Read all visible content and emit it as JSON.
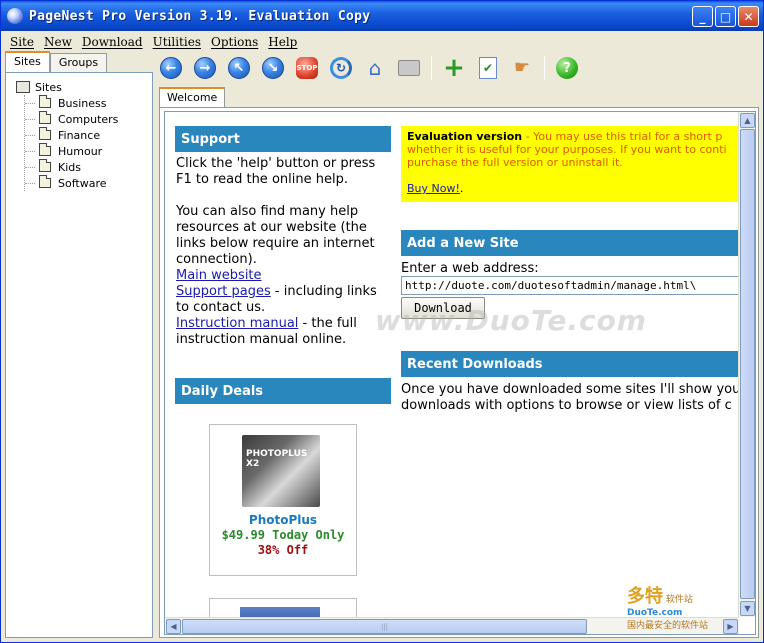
{
  "window": {
    "title": "PageNest Pro Version 3.19. Evaluation Copy",
    "controls": {
      "minimize": "_",
      "maximize": "□",
      "close": "✕"
    }
  },
  "menu": [
    "Site",
    "New",
    "Download",
    "Utilities",
    "Options",
    "Help"
  ],
  "left_tabs": [
    "Sites",
    "Groups"
  ],
  "tree": {
    "root": "Sites",
    "children": [
      "Business",
      "Computers",
      "Finance",
      "Humour",
      "Kids",
      "Software"
    ]
  },
  "toolbar": {
    "icons": [
      "back-icon",
      "forward-icon",
      "up-icon",
      "download-icon",
      "stop-icon",
      "refresh-icon",
      "home-icon",
      "print-icon",
      "add-icon",
      "checklist-icon",
      "hand-icon",
      "help-icon"
    ],
    "stop_label": "STOP"
  },
  "content_tab": "Welcome",
  "support": {
    "heading": "Support",
    "p1_line1": "Click the 'help' button or press",
    "p1_line2": "F1 to read the online help.",
    "p2_line1": "You can also find many help",
    "p2_line2": "resources at our website (the",
    "p2_line3": "links below require an internet",
    "p2_line4": "connection).",
    "link_main": "Main website",
    "link_support": "Support pages",
    "support_suffix": " - including links",
    "support_line2": "to contact us.",
    "link_manual": "Instruction manual",
    "manual_suffix": " - the full",
    "manual_line2": "instruction manual online."
  },
  "evaluation": {
    "title": "Evaluation version",
    "text1": " - You may use this trial for a short p",
    "text2": "whether it is useful for your purposes. If you want to conti",
    "text3": "purchase the full version or uninstall it.",
    "buy_link": "Buy Now!",
    "buy_suffix": "."
  },
  "add_site": {
    "heading": "Add a New Site",
    "label": "Enter a web address:",
    "value": "http://duote.com/duotesoftadmin/manage.html\\",
    "button": "Download"
  },
  "recent": {
    "heading": "Recent Downloads",
    "line1": "Once you have downloaded some sites I'll show you",
    "line2": "downloads with options to browse or view lists of c"
  },
  "deals": {
    "heading": "Daily Deals",
    "product_box_text": "PHOTOPLUS X2",
    "product": "PhotoPlus",
    "price": "$49.99 Today Only",
    "discount": "38% Off"
  },
  "watermark": "www.DuoTe.com",
  "corner_logo": {
    "big": "多特",
    "small": "软件站",
    "url": "DuoTe.com",
    "tagline": "国内最安全的软件站"
  },
  "colors": {
    "section_header": "#2a87bd",
    "eval_bg": "#ffff00",
    "link": "#1a1ab0"
  }
}
